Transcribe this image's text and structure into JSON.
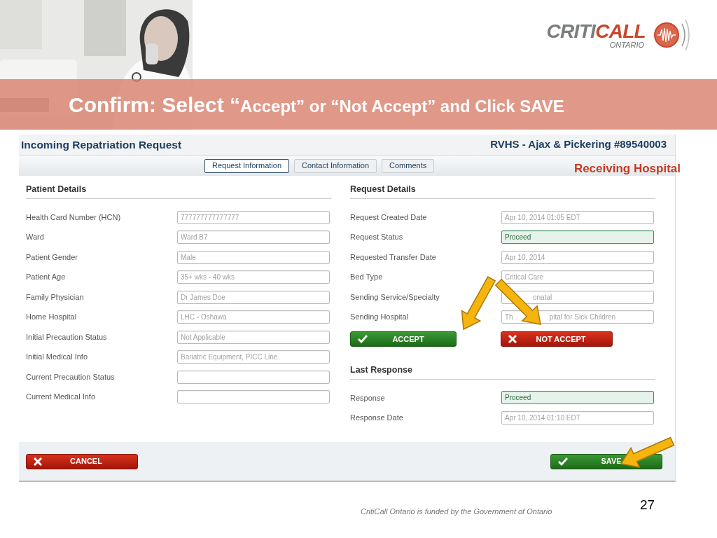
{
  "slide": {
    "title_main": "Confirm: Select “",
    "title_rest": "Accept” or “Not Accept” and Click SAVE",
    "page_number": "27",
    "footer": "CritiCall Ontario is funded by the Government of Ontario"
  },
  "logo": {
    "part1": "CRITI",
    "part2": "CALL",
    "subtitle": "ONTARIO"
  },
  "window": {
    "title": "Incoming Repatriation Request",
    "reference": "RVHS - Ajax & Pickering #89540003"
  },
  "tabs": [
    {
      "label": "Request Information",
      "selected": true
    },
    {
      "label": "Contact Information",
      "selected": false
    },
    {
      "label": "Comments",
      "selected": false
    }
  ],
  "annotation": "Receiving Hospital",
  "patient_details": {
    "heading": "Patient Details",
    "fields": [
      {
        "label": "Health Card Number (HCN)",
        "kind": "text",
        "value": "777777777777777"
      },
      {
        "label": "Ward",
        "kind": "text",
        "value": "Ward B7"
      },
      {
        "label": "Patient Gender",
        "kind": "text",
        "value": "Male"
      },
      {
        "label": "Patient Age",
        "kind": "text",
        "value": "35+ wks - 40 wks"
      },
      {
        "label": "Family Physician",
        "kind": "text",
        "value": "Dr James Doe"
      },
      {
        "label": "Home Hospital",
        "kind": "text",
        "value": "LHC - Oshawa"
      },
      {
        "label": "Initial Precaution Status",
        "kind": "text",
        "value": "Not Applicable"
      },
      {
        "label": "Initial Medical Info",
        "kind": "text",
        "value": "Bariatric Equipment, PICC Line"
      },
      {
        "label": "Current Precaution Status",
        "kind": "text"
      },
      {
        "label": "Current Medical Info",
        "kind": "text"
      }
    ]
  },
  "request_details": {
    "heading": "Request Details",
    "fields": [
      {
        "label": "Request Created Date",
        "kind": "text",
        "value": "Apr 10, 2014 01:05 EDT"
      },
      {
        "label": "Request Status",
        "kind": "status",
        "value": "Proceed"
      },
      {
        "label": "Requested Transfer Date",
        "kind": "text",
        "value": "Apr 10, 2014"
      },
      {
        "label": "Bed Type",
        "kind": "text",
        "value": "Critical Care"
      },
      {
        "label": "Sending Service/Specialty",
        "kind": "obscured",
        "value_parts": [
          "onatal"
        ]
      },
      {
        "label": "Sending Hospital",
        "kind": "obscured",
        "value_parts": [
          "Th",
          "pital for Sick Children"
        ]
      }
    ]
  },
  "decision_buttons": [
    {
      "label": "ACCEPT",
      "kind": "confirm"
    },
    {
      "label": "NOT ACCEPT",
      "kind": "reject"
    }
  ],
  "last_response": {
    "heading": "Last Response",
    "fields": [
      {
        "label": "Response",
        "kind": "status",
        "value": "Proceed"
      },
      {
        "label": "Response Date",
        "kind": "text",
        "value": "Apr 10, 2014 01:10 EDT"
      }
    ]
  },
  "footer_buttons": [
    {
      "label": "CANCEL",
      "kind": "reject"
    },
    {
      "label": "SAVE",
      "kind": "confirm"
    }
  ]
}
